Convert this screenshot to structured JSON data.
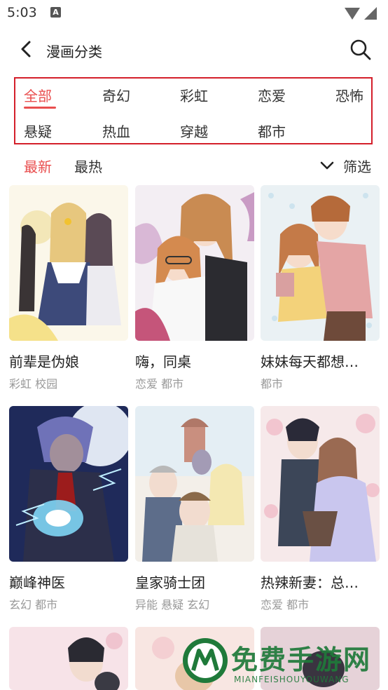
{
  "status": {
    "time": "5:03",
    "notif_icon": "A"
  },
  "header": {
    "title": "漫画分类"
  },
  "categories": [
    "全部",
    "奇幻",
    "彩虹",
    "恋爱",
    "恐怖",
    "悬疑",
    "热血",
    "穿越",
    "都市"
  ],
  "active_category": "全部",
  "sort": {
    "newest": "最新",
    "hottest": "最热",
    "active": "最新",
    "filter": "筛选"
  },
  "comics": [
    {
      "title": "前辈是伪娘",
      "tags": "彩虹 校园"
    },
    {
      "title": "嗨，同桌",
      "tags": "恋爱 都市"
    },
    {
      "title": "妹妹每天都想…",
      "tags": "都市"
    },
    {
      "title": "巅峰神医",
      "tags": "玄幻 都市"
    },
    {
      "title": "皇家骑士团",
      "tags": "异能 悬疑 玄幻"
    },
    {
      "title": "热辣新妻：总…",
      "tags": "恋爱 都市"
    }
  ],
  "watermark": {
    "text": "免费手游网",
    "sub": "MIANFEISHOUYOUWANG"
  },
  "colors": {
    "accent": "#e94e4e",
    "highlight_border": "#d41f2b"
  }
}
